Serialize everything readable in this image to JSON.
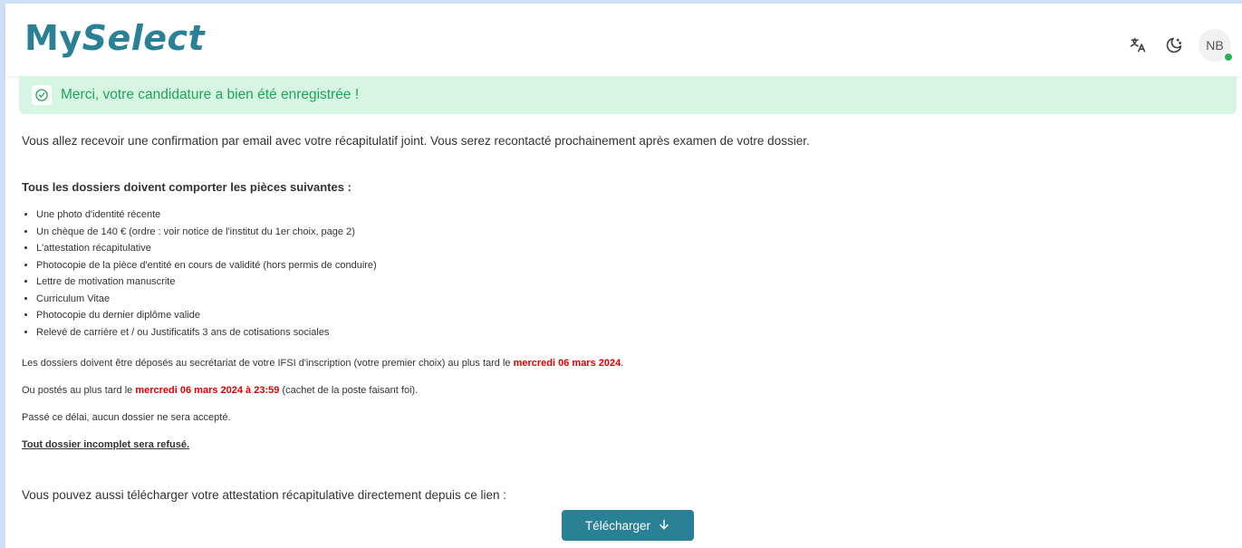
{
  "header": {
    "logo_part1": "My",
    "logo_part2": "Select",
    "avatar_initials": "NB"
  },
  "alert": {
    "message": "Merci, votre candidature a bien été enregistrée !"
  },
  "content": {
    "intro": "Vous allez recevoir une confirmation par email avec votre récapitulatif joint. Vous serez recontacté prochainement après examen de votre dossier.",
    "section_title": "Tous les dossiers doivent comporter les pièces suivantes :",
    "documents": [
      "Une photo d'identité récente",
      "Un chèque de 140 € (ordre : voir notice de l'institut du 1er choix, page 2)",
      "L'attestation récapitulative",
      "Photocopie de la pièce d'entité en cours de validité (hors permis de conduire)",
      "Lettre de motivation manuscrite",
      "Curriculum Vitae",
      "Photocopie du dernier diplôme valide",
      "Relevé de carrière et / ou Justificatifs 3 ans de cotisations sociales"
    ],
    "deposit_text_before": "Les dossiers doivent être déposés au secrétariat de votre IFSI d'inscription (votre premier choix) au plus tard le ",
    "deposit_date": "mercredi 06 mars 2024",
    "deposit_text_after": ".",
    "post_text_before": "Ou postés au plus tard le ",
    "post_date": "mercredi 06 mars 2024 à 23:59",
    "post_text_after": " (cachet de la poste faisant foi).",
    "deadline_note": "Passé ce délai, aucun dossier ne sera accepté.",
    "incomplete_note": "Tout dossier incomplet sera refusé.",
    "download_line": "Vous pouvez aussi télécharger votre attestation récapitulative directement depuis ce lien :",
    "download_button": "Télécharger"
  },
  "colors": {
    "brand": "#2a8196",
    "alert_bg": "#d6f5e3",
    "alert_text": "#22a35a",
    "highlight_red": "#e00000"
  }
}
